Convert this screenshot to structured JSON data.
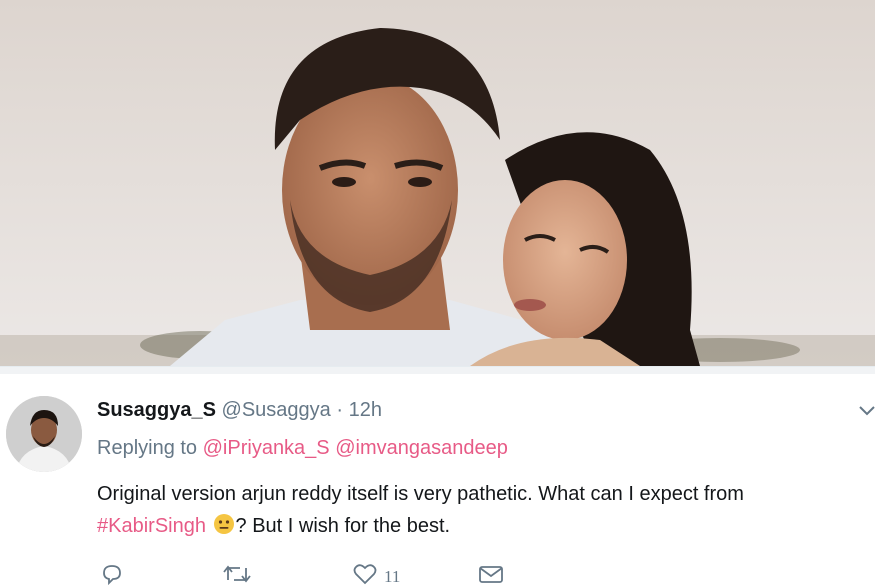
{
  "tweet": {
    "display_name": "Susaggya_S",
    "handle": "@Susaggya",
    "separator": "·",
    "time": "12h",
    "replying_prefix": "Replying to",
    "reply_mentions": [
      "@iPriyanka_S",
      "@imvangasandeep"
    ],
    "text_part1": "Original version arjun reddy itself is very pathetic. What can I expect from",
    "hashtag": "#KabirSingh",
    "text_part2": "? But I wish for the best.",
    "emoji_name": "neutral-face-emoji",
    "actions": {
      "reply_icon": "reply-icon",
      "retweet_icon": "retweet-icon",
      "like_icon": "heart-icon",
      "like_count": "11",
      "dm_icon": "envelope-icon"
    },
    "menu_icon": "chevron-down-icon"
  },
  "colors": {
    "name": "#14171a",
    "secondary": "#657786",
    "link": "#e0245e"
  }
}
